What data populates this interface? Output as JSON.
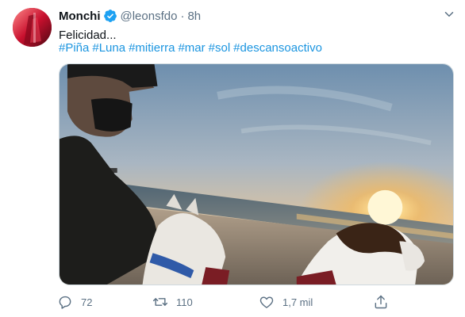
{
  "tweet": {
    "author": {
      "display_name": "Monchi",
      "handle": "@leonsfdo",
      "verified": true
    },
    "separator": "·",
    "time": "8h",
    "text": "Felicidad...",
    "hashtags": [
      "#Piña",
      "#Luna",
      "#mitierra",
      "#mar",
      "#sol",
      "#descansoactivo"
    ],
    "media": {
      "kind": "photo",
      "scene": "beach-sunset-with-dogs"
    },
    "actions": {
      "replies": "72",
      "retweets": "110",
      "likes": "1,7 mil"
    }
  },
  "icons": {
    "more": "more-dots-icon",
    "verified": "verified-badge-icon",
    "reply": "reply-icon",
    "retweet": "retweet-icon",
    "like": "heart-icon",
    "share": "share-icon"
  },
  "colors": {
    "accent": "#1b95e0",
    "verified": "#1da1f2",
    "muted": "#5b7083",
    "text": "#0f1419"
  }
}
